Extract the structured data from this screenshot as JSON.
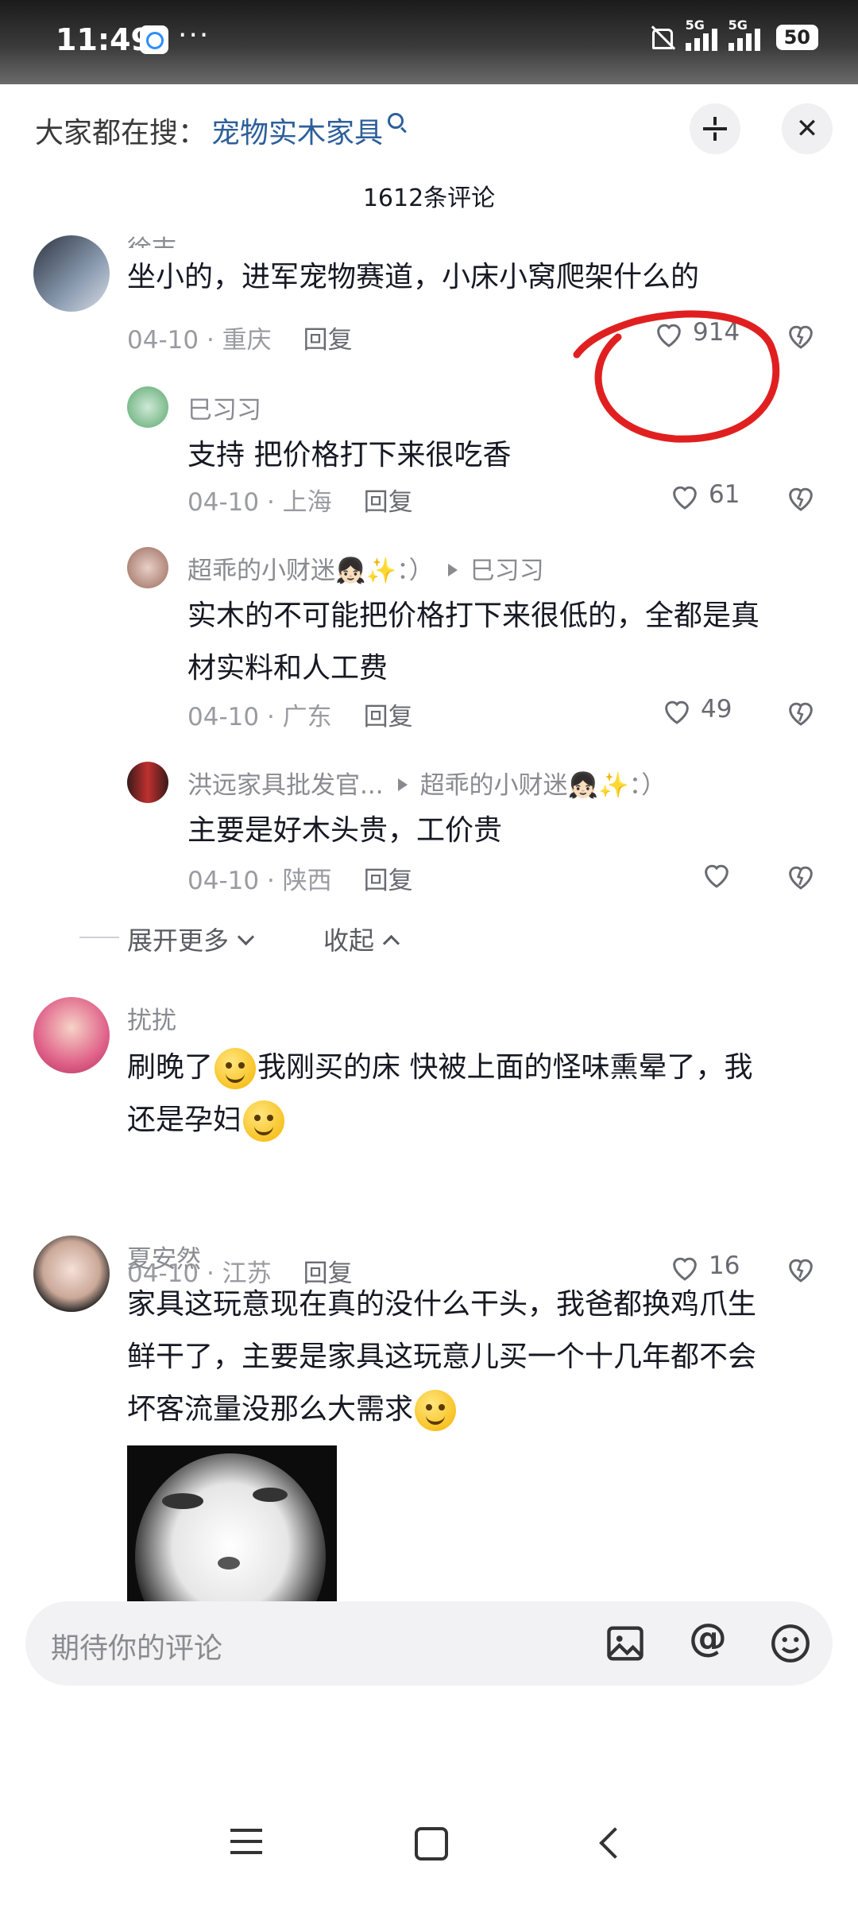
{
  "status_bar": {
    "time": "11:49",
    "dots": "···",
    "network1": "5G",
    "network2": "5G",
    "battery": "50"
  },
  "header": {
    "search_label": "大家都在搜：",
    "search_keyword": "宠物实木家具",
    "comment_count": "1612条评论"
  },
  "comments": [
    {
      "username": "徐志",
      "text": "坐小的，进军宠物赛道，小床小窝爬架什么的",
      "date": "04-10",
      "location": "重庆",
      "reply": "回复",
      "likes": "914"
    },
    {
      "username": "巳习习",
      "text": "支持 把价格打下来很吃香",
      "date": "04-10",
      "location": "上海",
      "reply": "回复",
      "likes": "61"
    },
    {
      "username": "超乖的小财迷👧🏻✨：）",
      "reply_to": "巳习习",
      "text_line1": "实木的不可能把价格打下来很低的，全都是真",
      "text_line2": "材实料和人工费",
      "date": "04-10",
      "location": "广东",
      "reply": "回复",
      "likes": "49"
    },
    {
      "username": "洪远家具批发官...",
      "reply_to": "超乖的小财迷👧🏻✨：）",
      "text": "主要是好木头贵，工价贵",
      "date": "04-10",
      "location": "陕西",
      "reply": "回复",
      "likes": ""
    },
    {
      "username": "扰扰",
      "text_part1": "刷晚了",
      "text_part2": "我刚买的床 快被上面的怪味熏晕了，我",
      "text_part3": "还是孕妇",
      "date": "04-10",
      "location": "江苏",
      "reply": "回复",
      "likes": "16"
    },
    {
      "username": "夏安然",
      "text_line1": "家具这玩意现在真的没什么干头，我爸都换鸡爪生",
      "text_line2": "鲜干了，主要是家具这玩意儿买一个十几年都不会",
      "text_line3": "坏客流量没那么大需求"
    }
  ],
  "thread_controls": {
    "expand_more": "展开更多",
    "collapse": "收起"
  },
  "input": {
    "placeholder": "期待你的评论",
    "at_symbol": "@"
  },
  "icons": [
    "search-icon",
    "collapse-icon",
    "close-icon",
    "heart-icon",
    "dislike-icon",
    "image-icon",
    "at-icon",
    "emoji-icon",
    "menu-icon",
    "home-icon",
    "back-icon"
  ],
  "colors": {
    "keyword_blue": "#2d5f9a",
    "annotation_red": "#e02020"
  }
}
